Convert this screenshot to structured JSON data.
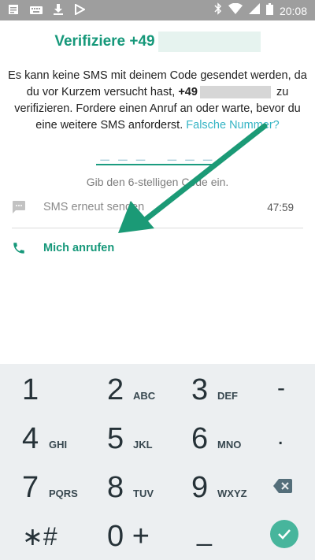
{
  "statusbar": {
    "time": "20:08"
  },
  "header": {
    "title": "Verifiziere +49",
    "desc_1": "Es kann keine SMS mit deinem Code gesendet werden, da du vor Kurzem versucht hast,",
    "desc_prefix": "+49",
    "desc_2": "zu verifizieren. Fordere einen Anruf an oder warte, bevor du eine weitere SMS anforderst.",
    "wrong_number_link": "Falsche Nummer?"
  },
  "code": {
    "placeholder": "_ _ _   _ _ _",
    "hint": "Gib den 6-stelligen Code ein."
  },
  "options": {
    "resend_label": "SMS erneut senden",
    "resend_timer": "47:59",
    "call_label": "Mich anrufen"
  },
  "keypad": {
    "keys": [
      {
        "num": "1",
        "letters": ""
      },
      {
        "num": "2",
        "letters": "ABC"
      },
      {
        "num": "3",
        "letters": "DEF"
      },
      {
        "num": "-",
        "letters": ""
      },
      {
        "num": "4",
        "letters": "GHI"
      },
      {
        "num": "5",
        "letters": "JKL"
      },
      {
        "num": "6",
        "letters": "MNO"
      },
      {
        "num": ".",
        "letters": ""
      },
      {
        "num": "7",
        "letters": "PQRS"
      },
      {
        "num": "8",
        "letters": "TUV"
      },
      {
        "num": "9",
        "letters": "WXYZ"
      },
      {
        "num": "∗#",
        "letters": ""
      },
      {
        "num": "0 +",
        "letters": ""
      },
      {
        "num": "_",
        "letters": ""
      }
    ]
  },
  "colors": {
    "accent": "#16987a",
    "link": "#34b4c4",
    "arrow": "#1b9a76",
    "done": "#47b59c"
  }
}
